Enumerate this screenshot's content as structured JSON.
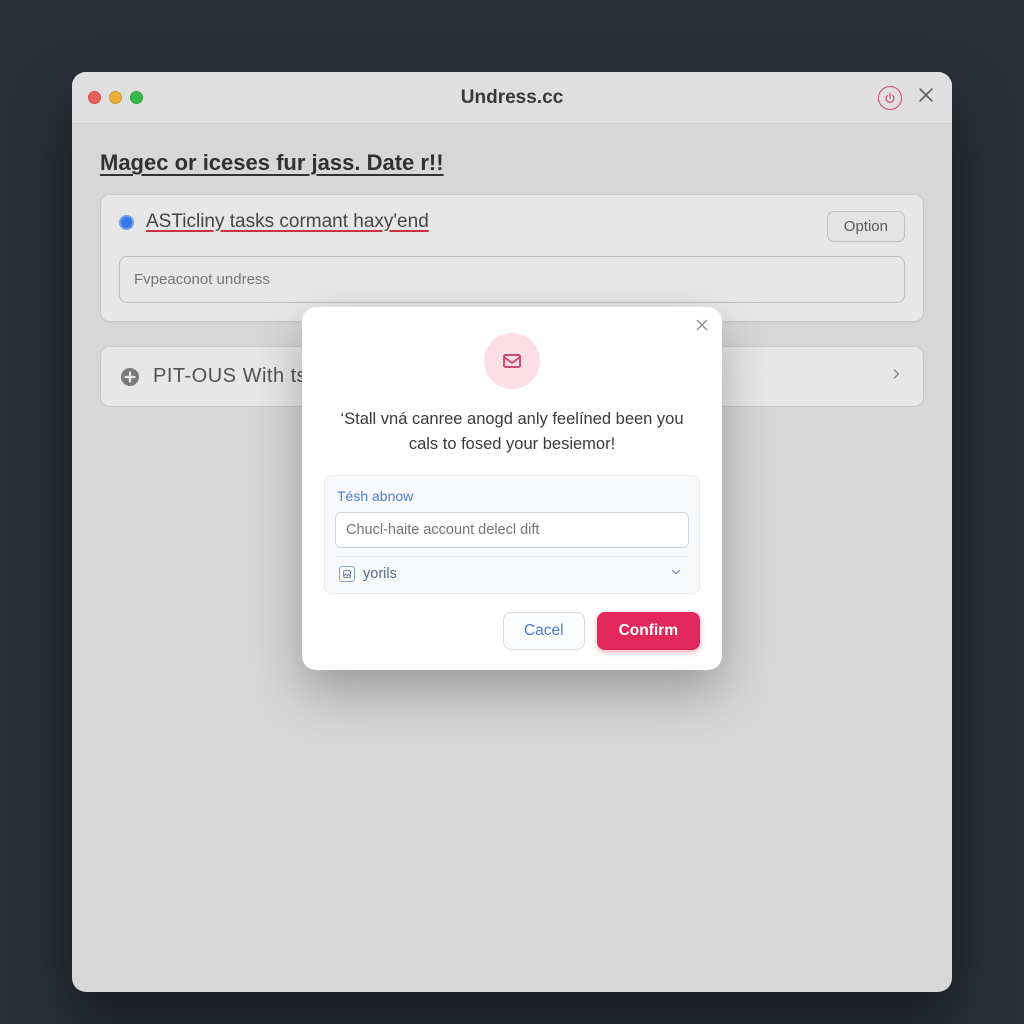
{
  "window": {
    "title": "Undress.cc"
  },
  "page": {
    "headline": "Magec or iceses fur jass. Date r!!",
    "card": {
      "title": "ASTicliny tasks cormant haxy'end",
      "input_placeholder": "Fvpeaconot undress",
      "option_label": "Option"
    },
    "row": {
      "title": "PIT-OUS With tsk"
    }
  },
  "modal": {
    "message": "‘Stall vná canree anogd anly feelíned been you cals to fosed your besiemor!",
    "form_label": "Tésh abnow",
    "input_placeholder": "Chucl-haite account delecl dift",
    "select_label": "yorils",
    "cancel_label": "Cacel",
    "confirm_label": "Confirm"
  },
  "icons": {
    "traffic_red": "close",
    "traffic_yellow": "minimize",
    "traffic_green": "zoom",
    "power": "power-icon",
    "window_close": "close-icon",
    "plus": "plus-icon",
    "chevron_right": "chevron-right-icon",
    "modal_warning": "mail-warning-icon",
    "modal_close": "close-icon",
    "select_badge": "image-icon",
    "select_chevron": "chevron-down-icon"
  },
  "colors": {
    "accent_danger": "#e2285a",
    "accent_blue": "#2478ff",
    "modal_icon_bg": "#fcdfe6",
    "modal_icon_fg": "#d34b73"
  }
}
